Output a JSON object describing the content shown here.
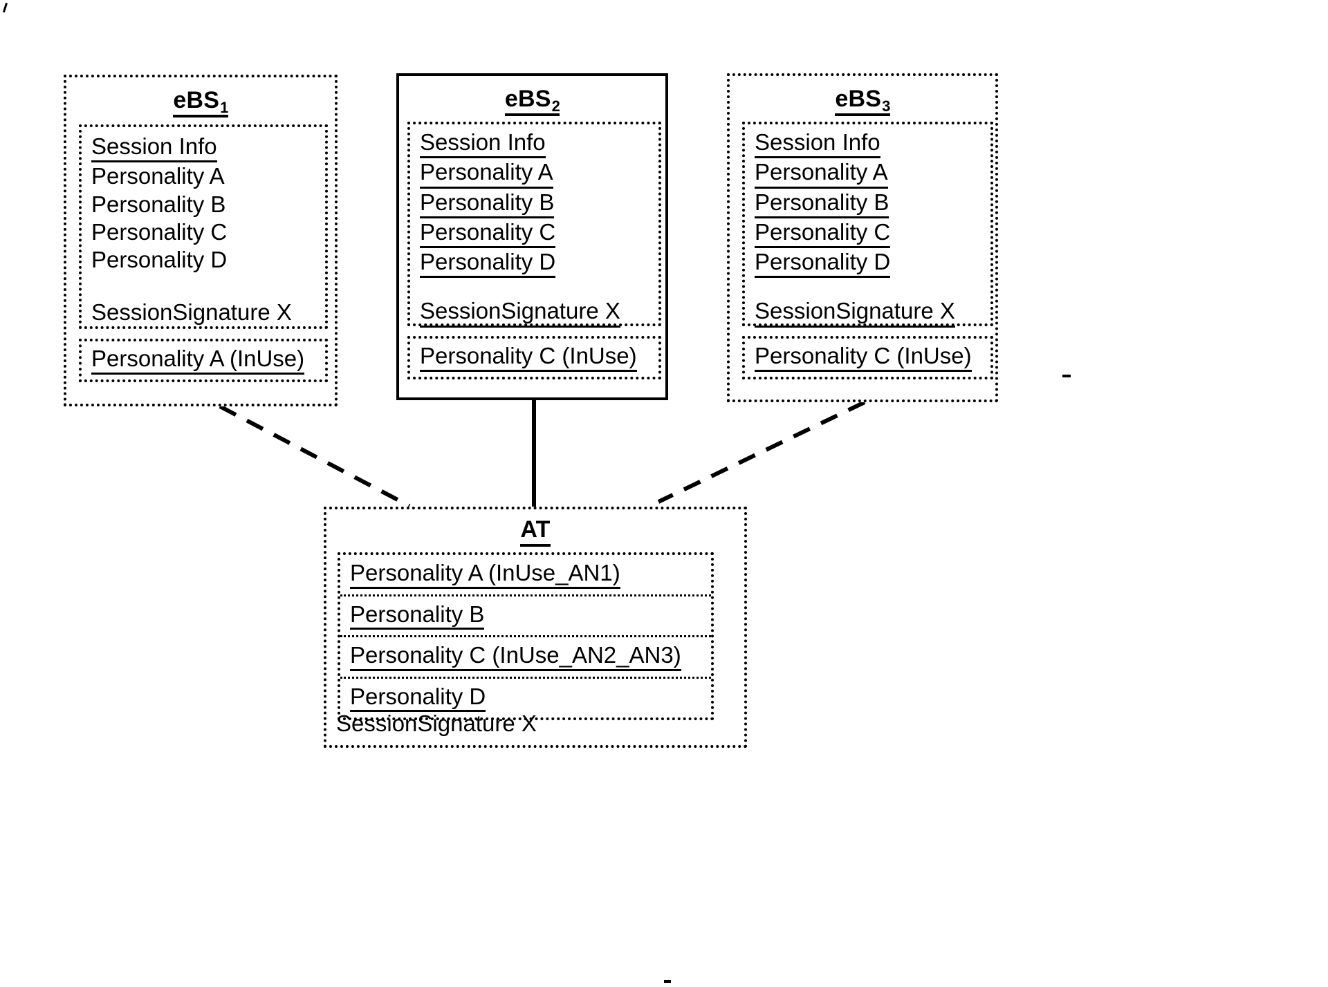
{
  "diagram": {
    "type": "network-session-state-diagram",
    "nodes": [
      {
        "id": "ebs1",
        "title": "eBS",
        "title_sub": "1",
        "border_style": "dotted",
        "section_header": "Session Info",
        "section_header_underlined": true,
        "items": [
          {
            "label": "Personality A",
            "underlined": false
          },
          {
            "label": "Personality B",
            "underlined": false
          },
          {
            "label": "Personality C",
            "underlined": false
          },
          {
            "label": "Personality D",
            "underlined": false
          }
        ],
        "signature": "SessionSignature X",
        "signature_underlined": false,
        "inuse_strip": "Personality A (InUse)",
        "inuse_strip_underlined": true
      },
      {
        "id": "ebs2",
        "title": "eBS",
        "title_sub": "2",
        "border_style": "solid",
        "section_header": "Session Info",
        "section_header_underlined": true,
        "items": [
          {
            "label": "Personality A",
            "underlined": true
          },
          {
            "label": "Personality B",
            "underlined": true
          },
          {
            "label": "Personality C",
            "underlined": true
          },
          {
            "label": "Personality D",
            "underlined": true
          }
        ],
        "signature": "SessionSignature X",
        "signature_underlined": true,
        "inuse_strip": "Personality C (InUse)",
        "inuse_strip_underlined": true
      },
      {
        "id": "ebs3",
        "title": "eBS",
        "title_sub": "3",
        "border_style": "dotted",
        "section_header": "Session Info",
        "section_header_underlined": true,
        "items": [
          {
            "label": "Personality A",
            "underlined": true
          },
          {
            "label": "Personality B",
            "underlined": true
          },
          {
            "label": "Personality C",
            "underlined": true
          },
          {
            "label": "Personality D",
            "underlined": true
          }
        ],
        "signature": "SessionSignature X",
        "signature_underlined": true,
        "inuse_strip": "Personality C (InUse)",
        "inuse_strip_underlined": true
      }
    ],
    "at_node": {
      "id": "at",
      "title": "AT",
      "title_underlined": true,
      "border_style": "dotted",
      "rows": [
        {
          "label": "Personality A (InUse_AN1)",
          "underlined": true
        },
        {
          "label": "Personality B",
          "underlined": true
        },
        {
          "label": "Personality C (InUse_AN2_AN3)",
          "underlined": true
        },
        {
          "label": "Personality D",
          "underlined": true
        }
      ],
      "signature": "SessionSignature X",
      "signature_underlined": false
    },
    "connections": [
      {
        "from": "ebs1",
        "to": "at",
        "style": "dashed"
      },
      {
        "from": "ebs2",
        "to": "at",
        "style": "solid"
      },
      {
        "from": "ebs3",
        "to": "at",
        "style": "dashed"
      }
    ],
    "colors": {
      "ink": "#000000",
      "background": "#ffffff"
    }
  }
}
